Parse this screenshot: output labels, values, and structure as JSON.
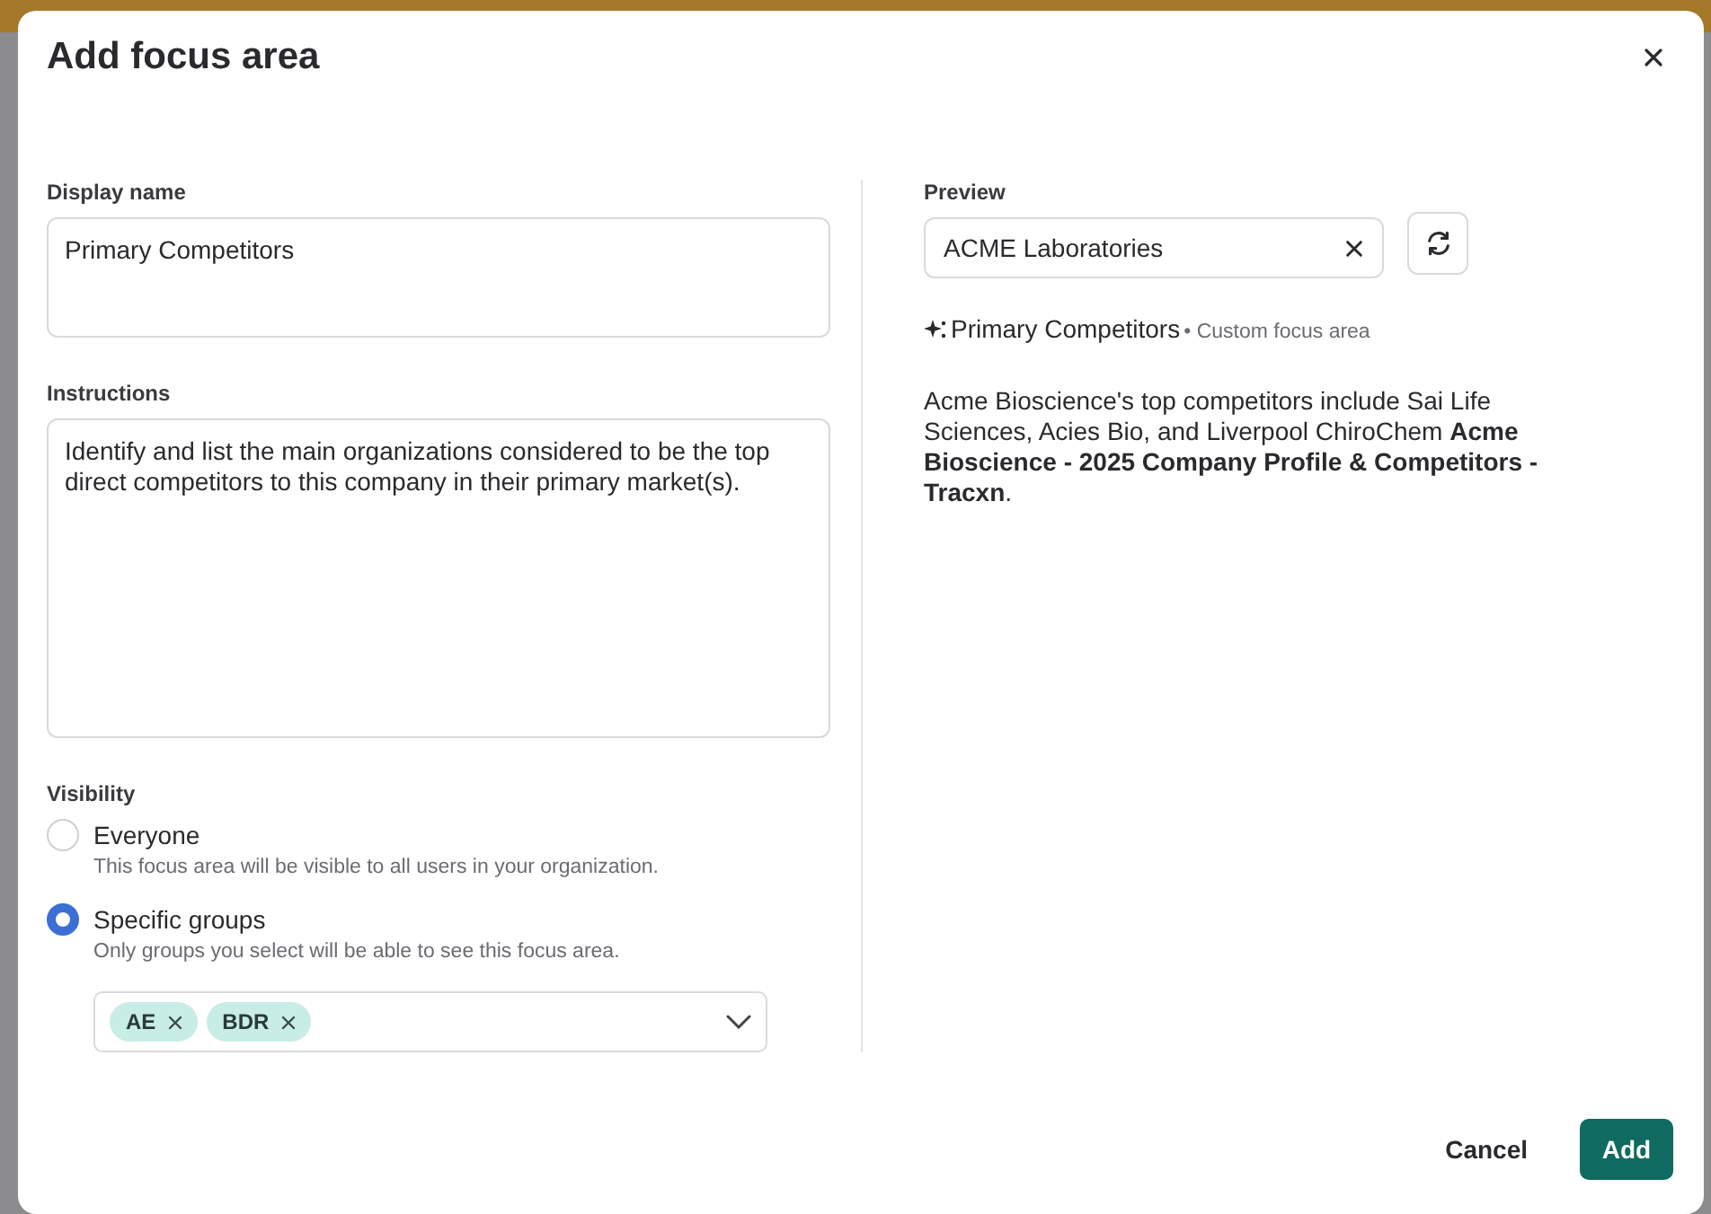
{
  "dialog": {
    "title": "Add focus area",
    "display_name": {
      "label": "Display name",
      "value": "Primary Competitors"
    },
    "instructions": {
      "label": "Instructions",
      "value": "Identify and list the main organizations considered to be the top direct competitors to this company in their primary market(s)."
    },
    "visibility": {
      "label": "Visibility",
      "options": [
        {
          "label": "Everyone",
          "description": "This focus area will be visible to all users in your organization.",
          "selected": false
        },
        {
          "label": "Specific groups",
          "description": "Only groups you select will be able to see this focus area.",
          "selected": true
        }
      ]
    },
    "groups": [
      "AE",
      "BDR"
    ],
    "preview": {
      "label": "Preview",
      "company": "ACME Laboratories",
      "focus_name": "Primary Competitors",
      "focus_type": "• Custom focus area",
      "text": "Acme Bioscience's top competitors include Sai Life Sciences, Acies Bio, and Liverpool ChiroChem **Acme Bioscience - 2025 Company Profile & Competitors - Tracxn**."
    },
    "buttons": [
      {
        "label": "Cancel",
        "kind": "secondary"
      },
      {
        "label": "Add",
        "kind": "primary"
      }
    ]
  }
}
